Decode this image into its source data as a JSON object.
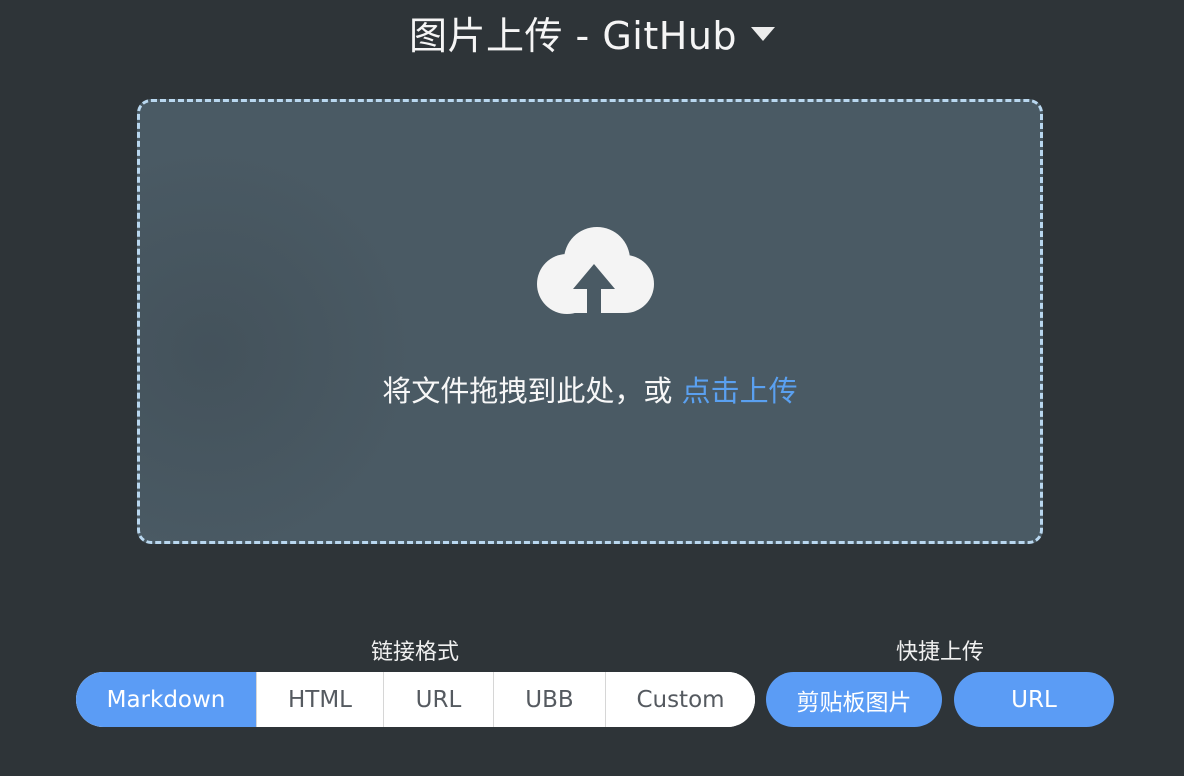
{
  "header": {
    "title": "图片上传 - GitHub",
    "picker_icon": "caret-down-icon"
  },
  "drop_zone": {
    "icon": "cloud-upload-icon",
    "prompt_text": "将文件拖拽到此处，或 ",
    "click_upload_label": "点击上传"
  },
  "link_format": {
    "label": "链接格式",
    "options": [
      "Markdown",
      "HTML",
      "URL",
      "UBB",
      "Custom"
    ],
    "selected": "Markdown"
  },
  "quick_upload": {
    "label": "快捷上传",
    "clipboard_label": "剪贴板图片",
    "url_label": "URL"
  },
  "colors": {
    "background": "#2e3438",
    "drop_zone_fill": "#4a5a64",
    "drop_zone_border": "#b9d7ef",
    "accent": "#5b9cf5",
    "link": "#5aa0f0"
  }
}
